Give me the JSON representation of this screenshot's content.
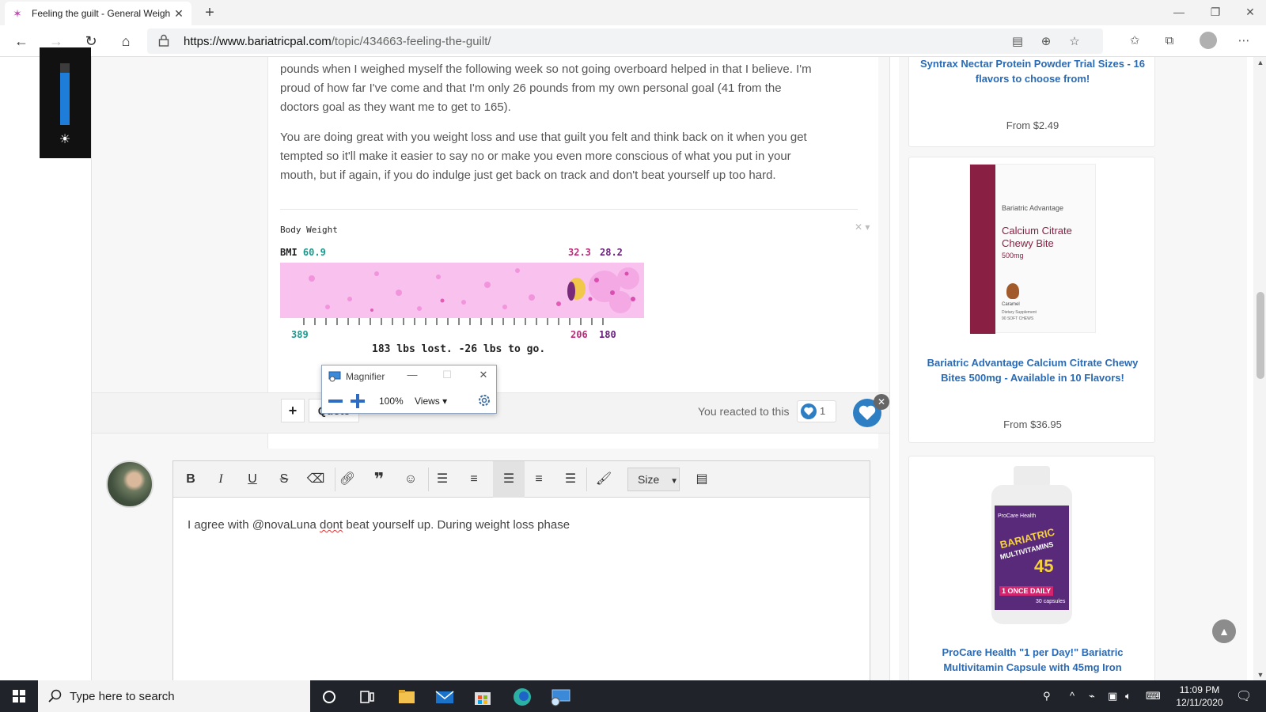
{
  "browser": {
    "tab_title": "Feeling the guilt - General Weigh",
    "url_domain": "https://www.bariatricpal.com",
    "url_path": "/topic/434663-feeling-the-guilt/",
    "window_controls": {
      "minimize": "—",
      "maximize": "❐",
      "close": "✕"
    }
  },
  "post": {
    "para1_line0": "pounds when I weighed myself the following week so not going overboard helped in that I believe. I'm",
    "para1_line1": "proud of how far I've come and that I'm only 26 pounds from my own personal goal (41 from the",
    "para1_line2": "doctors goal as they want me to get to 165).",
    "para2_line0": "You are doing great with you weight loss and use that guilt you felt and think back on it when you get",
    "para2_line1": "tempted so it'll make it easier to say no or make you even more conscious of what you put in your",
    "para2_line2": "mouth, but if again, if you do indulge just get back on track and don't beat yourself up too hard.",
    "ticker": {
      "title": "Body Weight",
      "bmi_label": "BMI",
      "bmi_start": "60.9",
      "bmi_current": "32.3",
      "bmi_goal": "28.2",
      "start_weight": "389",
      "current_weight": "206",
      "goal_weight": "180",
      "summary": "183 lbs lost. -26 lbs to go.",
      "close_glyph": "✕ ▾"
    },
    "footer": {
      "plus_label": "+",
      "quote_label": "Quote",
      "reacted_text": "You reacted to this",
      "reaction_count": "1",
      "close_badge": "✕"
    }
  },
  "editor": {
    "size_label": "Size",
    "text_before": "I agree with @novaLuna ",
    "text_misspelled": "dont",
    "text_after": " beat yourself up.  During weight loss phase"
  },
  "sidebar": {
    "products": [
      {
        "title": "Syntrax Nectar Protein Powder Trial Sizes - 16 flavors to choose from!",
        "price": "From $2.49"
      },
      {
        "title": "Bariatric Advantage Calcium Citrate Chewy Bites 500mg - Available in 10 Flavors!",
        "price": "From $36.95",
        "pkg_brand": "Bariatric Advantage",
        "pkg_line1": "Calcium Citrate",
        "pkg_line2": "Chewy Bite",
        "pkg_line3": "500mg",
        "pkg_flavor": "Caramel",
        "pkg_note1": "Dietary Supplement",
        "pkg_note2": "90 SOFT CHEWS"
      },
      {
        "title": "ProCare Health \"1 per Day!\" Bariatric Multivitamin Capsule with 45mg Iron",
        "price": "",
        "pkg_brand": "ProCare Health",
        "pkg_line1": "BARIATRIC",
        "pkg_line2": "MULTIVITAMINS",
        "pkg_line3": "45",
        "pkg_line4": "1 ONCE DAILY",
        "pkg_count": "30 capsules"
      }
    ]
  },
  "magnifier": {
    "title": "Magnifier",
    "zoom": "100%",
    "views_label": "Views ▾"
  },
  "taskbar": {
    "search_placeholder": "Type here to search",
    "time": "11:09 PM",
    "date": "12/11/2020"
  },
  "colors": {
    "link_blue": "#2a6bb5",
    "ticker_pink": "#f8c1ee",
    "bmi_teal": "#1a9a8e",
    "bmi_magenta": "#c0297c",
    "bmi_purple": "#6a1d7e",
    "heart_blue": "#2e7ec4"
  },
  "icons": [
    "back-arrow-icon",
    "forward-arrow-icon",
    "refresh-icon",
    "home-icon",
    "lock-icon",
    "read-aloud-icon",
    "zoom-icon",
    "favorite-star-icon",
    "favorites-icon",
    "collections-icon",
    "profile-icon",
    "more-icon",
    "bold-icon",
    "italic-icon",
    "underline-icon",
    "strikethrough-icon",
    "eraser-icon",
    "link-icon",
    "quote-icon",
    "emoji-icon",
    "bullet-list-icon",
    "number-list-icon",
    "align-left-icon",
    "align-center-icon",
    "align-right-icon",
    "brush-icon",
    "source-icon",
    "heart-icon",
    "brightness-sun-icon",
    "magnifier-icon",
    "gear-icon",
    "windows-start-icon",
    "search-icon",
    "task-view-icon",
    "file-explorer-icon",
    "mail-icon",
    "store-icon",
    "edge-icon"
  ]
}
